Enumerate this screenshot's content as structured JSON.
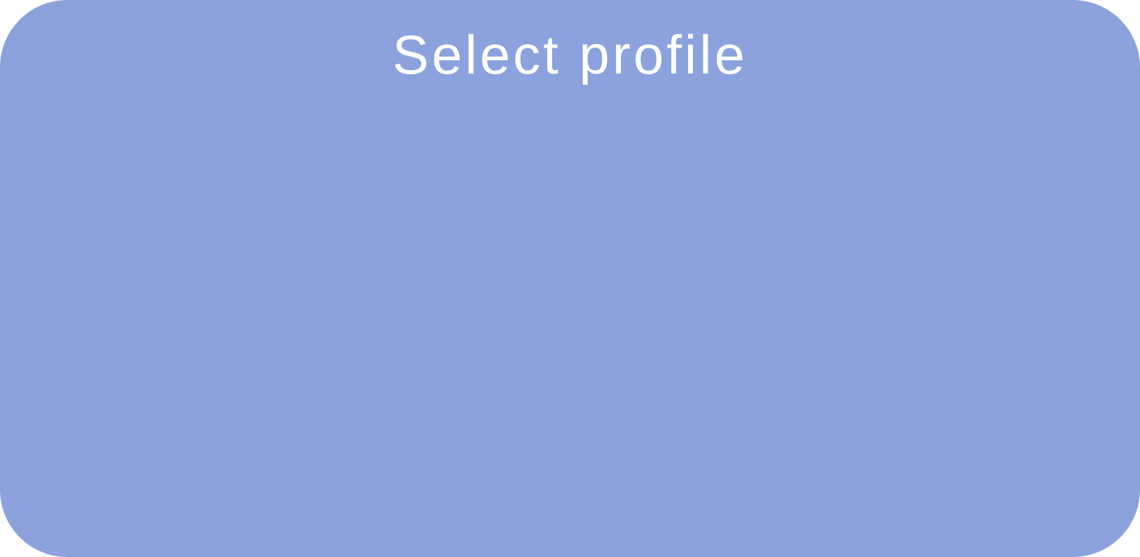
{
  "dialog": {
    "title": "Select profile"
  },
  "colors": {
    "panel_background": "#8ba2dd",
    "title_text": "#ffffff"
  }
}
